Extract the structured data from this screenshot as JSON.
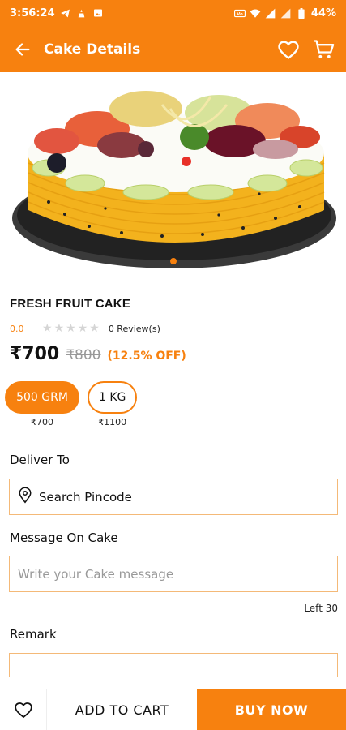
{
  "status_bar": {
    "time": "3:56:24",
    "battery": "44%",
    "left_icons": [
      "telegram-icon",
      "alert-icon",
      "image-icon"
    ],
    "right_icons": [
      "volte-icon",
      "wifi-icon",
      "signal-icon",
      "signal-icon",
      "battery-icon"
    ]
  },
  "header": {
    "title": "Cake Details",
    "back_icon": "arrow-left-icon",
    "wishlist_icon": "heart-icon",
    "cart_icon": "cart-icon"
  },
  "product": {
    "name": "FRESH FRUIT CAKE",
    "rating": "0.0",
    "stars": 5,
    "stars_filled": 0,
    "reviews": "0 Review(s)",
    "price": "₹700",
    "mrp": "₹800",
    "discount": "(12.5% OFF)",
    "carousel_index": 1,
    "carousel_count": 1
  },
  "weights": [
    {
      "label": "500 GRM",
      "price": "₹700",
      "selected": true
    },
    {
      "label": "1 KG",
      "price": "₹1100",
      "selected": false
    }
  ],
  "deliver": {
    "label": "Deliver To",
    "value": "Search Pincode",
    "icon": "location-pin-icon"
  },
  "message": {
    "label": "Message On Cake",
    "placeholder": "Write your Cake message",
    "counter": "Left 30"
  },
  "remark": {
    "label": "Remark"
  },
  "bottom": {
    "wishlist_icon": "heart-icon",
    "add_to_cart": "ADD TO CART",
    "buy_now": "BUY NOW"
  },
  "colors": {
    "accent": "#f7810f",
    "field_border": "#f4b978"
  }
}
